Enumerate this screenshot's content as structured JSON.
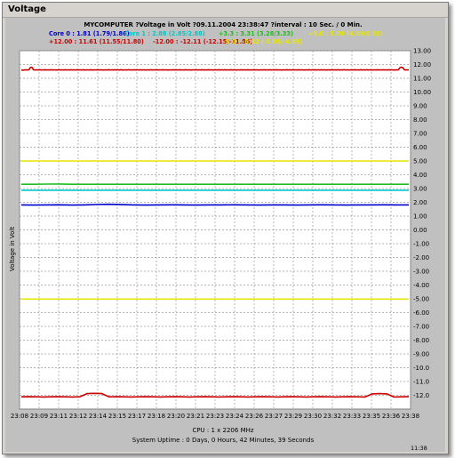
{
  "window": {
    "title": "Voltage"
  },
  "chart_data": {
    "type": "line",
    "title": "MYCOMPUTER ?Voltage in Volt ?09.11.2004 23:38:47 ?interval : 10 Sec. / 0 Min.",
    "ylabel": "Voltage in Volt",
    "footer_cpu": "CPU : 1 x 2206 MHz",
    "footer_uptime": "System Uptime : 0 Days, 0 Hours, 42 Minutes, 39 Seconds",
    "clock": "11:38",
    "ylim": [
      -13,
      13
    ],
    "grid": true,
    "yticks": [
      "13.00",
      "12.00",
      "11.00",
      "10.00",
      "9.00",
      "8.00",
      "7.00",
      "6.00",
      "5.00",
      "4.00",
      "3.00",
      "2.00",
      "1.00",
      "0.00",
      "-1.00",
      "-2.00",
      "-3.00",
      "-4.00",
      "-5.00",
      "-6.00",
      "-7.00",
      "-8.00",
      "-9.00",
      "-10.0",
      "-11.0",
      "-12.0"
    ],
    "xticks": [
      "23:08",
      "23:09",
      "23:11",
      "23:12",
      "23:14",
      "23:15",
      "23:17",
      "23:18",
      "23:20",
      "23:21",
      "23:23",
      "23:24",
      "23:26",
      "23:27",
      "23:29",
      "23:30",
      "23:32",
      "23:33",
      "23:35",
      "23:36",
      "23:38"
    ],
    "legend": [
      {
        "text": "Core 0 : 1.81 (1.79/1.86)",
        "color": "#0000cc"
      },
      {
        "text": "Core 1 : 2.88 (2.85/2.88)",
        "color": "#00c8c8"
      },
      {
        "text": "+3.3 : 3.31 (3.28/3.33)",
        "color": "#22bb22"
      },
      {
        "text": "+5.0 : 5.00 (4.99/5.03)",
        "color": "#e6e600"
      },
      {
        "text": "+12.00 : 11.61 (11.55/11.80)",
        "color": "#cc0000"
      },
      {
        "text": "-12.00 : -12.11 (-12.15/-11.86)",
        "color": "#cc0000"
      },
      {
        "text": "-5.0 : -5.02 (-5.05/-4.98)",
        "color": "#e6e600"
      }
    ],
    "series": [
      {
        "name": "+12.00",
        "color": "#cc0000",
        "values": [
          11.6,
          11.58,
          11.6,
          11.62,
          11.6,
          11.61,
          11.78,
          11.8,
          11.62,
          11.6,
          11.61,
          11.6,
          11.62,
          11.6,
          11.61,
          11.6,
          11.62,
          11.6,
          11.61,
          11.6,
          11.62,
          11.6,
          11.61,
          11.6,
          11.6,
          11.62,
          11.6,
          11.61,
          11.6,
          11.62,
          11.6,
          11.61,
          11.6,
          11.62,
          11.6,
          11.61,
          11.6,
          11.62,
          11.6,
          11.61,
          11.6,
          11.62,
          11.6,
          11.6,
          11.61,
          11.6,
          11.62,
          11.6,
          11.6,
          11.61,
          11.6,
          11.62,
          11.6,
          11.61,
          11.6,
          11.6,
          11.61,
          11.6,
          11.62,
          11.6,
          11.61,
          11.6,
          11.62,
          11.6,
          11.61,
          11.6,
          11.62,
          11.6,
          11.6,
          11.61,
          11.6,
          11.62,
          11.6,
          11.61,
          11.6,
          11.62,
          11.6,
          11.61,
          11.6,
          11.62,
          11.6,
          11.61,
          11.6,
          11.6,
          11.61,
          11.6,
          11.62,
          11.6,
          11.61,
          11.6,
          11.62,
          11.6,
          11.61,
          11.6,
          11.62,
          11.6,
          11.61,
          11.6,
          11.6,
          11.61,
          11.6,
          11.62,
          11.6,
          11.61,
          11.6,
          11.62,
          11.6,
          11.61,
          11.6,
          11.62,
          11.6,
          11.61,
          11.6,
          11.6,
          11.61,
          11.6,
          11.62,
          11.6,
          11.61,
          11.6,
          11.62,
          11.6,
          11.61,
          11.6,
          11.62,
          11.6,
          11.61,
          11.6,
          11.6,
          11.61,
          11.6,
          11.62,
          11.6,
          11.61,
          11.6,
          11.62,
          11.6,
          11.61,
          11.6,
          11.62,
          11.6,
          11.61,
          11.6,
          11.6,
          11.61,
          11.6,
          11.62,
          11.6,
          11.61,
          11.6,
          11.62,
          11.6,
          11.61,
          11.6,
          11.62,
          11.6,
          11.61,
          11.6,
          11.6,
          11.61,
          11.6,
          11.62,
          11.6,
          11.61,
          11.6,
          11.62,
          11.6,
          11.61,
          11.6,
          11.62,
          11.6,
          11.61,
          11.6,
          11.6,
          11.61,
          11.6,
          11.62,
          11.6,
          11.61,
          11.6,
          11.62,
          11.6,
          11.61,
          11.6,
          11.62,
          11.6,
          11.61,
          11.6,
          11.6,
          11.61,
          11.6,
          11.62,
          11.6,
          11.61,
          11.6,
          11.62,
          11.6,
          11.61,
          11.6,
          11.62,
          11.6,
          11.61,
          11.6,
          11.6,
          11.61,
          11.6,
          11.62,
          11.6,
          11.61,
          11.6,
          11.62,
          11.6,
          11.61,
          11.6,
          11.62,
          11.6,
          11.61,
          11.6,
          11.6,
          11.61,
          11.6,
          11.62,
          11.6,
          11.61,
          11.6,
          11.62,
          11.6,
          11.61,
          11.6,
          11.62,
          11.6,
          11.61,
          11.6,
          11.6,
          11.61,
          11.6,
          11.62,
          11.6,
          11.61,
          11.6,
          11.62,
          11.6,
          11.61,
          11.6,
          11.62,
          11.6,
          11.61,
          11.6,
          11.6,
          11.61,
          11.6,
          11.75,
          11.8,
          11.78,
          11.62,
          11.6,
          11.61,
          11.6
        ]
      },
      {
        "name": "+5.0",
        "color": "#e6e600",
        "values": [
          5.0,
          5.0
        ]
      },
      {
        "name": "+3.3",
        "color": "#22bb22",
        "values": [
          3.31,
          3.31,
          3.32,
          3.33,
          3.31,
          3.31,
          3.31,
          3.31,
          3.31,
          3.31,
          3.31,
          3.31,
          3.31,
          3.31,
          3.31,
          3.31,
          3.31,
          3.31,
          3.31,
          3.31,
          3.31,
          3.31,
          3.31,
          3.31,
          3.31,
          3.31,
          3.31,
          3.31,
          3.31,
          3.31,
          3.31,
          3.31
        ]
      },
      {
        "name": "Core 1",
        "color": "#00c8c8",
        "values": [
          2.88,
          2.88
        ]
      },
      {
        "name": "Core 0",
        "color": "#0000cc",
        "values": [
          1.81,
          1.8,
          1.81,
          1.82,
          1.8,
          1.81,
          1.84,
          1.86,
          1.83,
          1.81,
          1.8,
          1.81,
          1.82,
          1.81,
          1.8,
          1.81,
          1.81,
          1.82,
          1.81,
          1.8,
          1.81,
          1.81,
          1.8,
          1.81,
          1.82,
          1.81,
          1.8,
          1.81,
          1.81,
          1.82,
          1.81,
          1.81
        ]
      },
      {
        "name": "-5.0",
        "color": "#e6e600",
        "values": [
          -5.02,
          -5.02
        ]
      },
      {
        "name": "-12.00",
        "color": "#cc0000",
        "values": [
          -12.11,
          -12.1,
          -12.11,
          -12.12,
          -12.11,
          -12.1,
          -12.11,
          -12.12,
          -12.11,
          -11.88,
          -11.86,
          -11.88,
          -12.11,
          -12.1,
          -12.11,
          -12.12,
          -12.11,
          -12.1,
          -12.11,
          -12.12,
          -12.11,
          -12.1,
          -12.11,
          -12.12,
          -12.11,
          -12.1,
          -12.11,
          -12.12,
          -12.11,
          -12.1,
          -12.11,
          -12.12,
          -12.11,
          -12.1,
          -12.11,
          -12.12,
          -12.11,
          -12.1,
          -12.11,
          -12.12,
          -12.11,
          -12.1,
          -12.11,
          -12.12,
          -12.11,
          -12.1,
          -12.11,
          -12.12,
          -11.9,
          -11.88,
          -11.9,
          -12.12,
          -12.11,
          -12.1
        ]
      }
    ]
  }
}
